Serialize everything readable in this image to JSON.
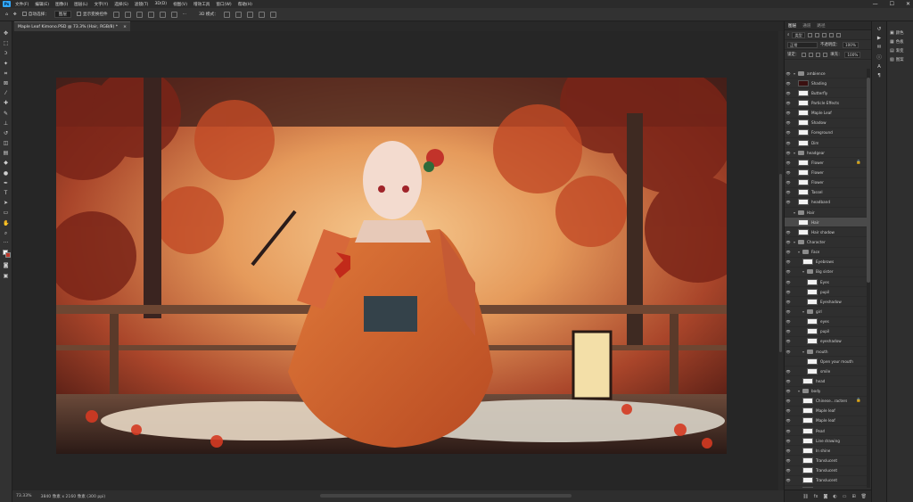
{
  "menu": {
    "items": [
      "文件(F)",
      "编辑(E)",
      "图像(I)",
      "图层(L)",
      "文字(Y)",
      "选择(S)",
      "滤镜(T)",
      "3D(D)",
      "视图(V)",
      "增效工具",
      "窗口(W)",
      "帮助(H)"
    ],
    "logo": "Ps",
    "window_controls": [
      "—",
      "☐",
      "✕"
    ]
  },
  "options": {
    "auto_select_label": "自动选择：",
    "layer_mode": "图层",
    "show_transform_label": "显示变换控件"
  },
  "document": {
    "tab_title": "Maple Leaf Kimono.PSD @ 73.3% (Hair, RGB/8) *",
    "tab_close": "×"
  },
  "status": {
    "zoom": "73.33%",
    "doc_info": "3840 像素 x 2160 像素 (300 ppi)"
  },
  "layers_panel": {
    "tabs": [
      "图层",
      "通道",
      "路径"
    ],
    "filter_label": "类型",
    "blend_mode": "正常",
    "opacity_label": "不透明度：",
    "opacity_value": "100%",
    "lock_label": "锁定：",
    "fill_label": "填充：",
    "fill_value": "100%",
    "layers": [
      {
        "name": "ambience",
        "type": "group",
        "indent": 0,
        "visible": true
      },
      {
        "name": "Shading",
        "type": "layer",
        "indent": 1,
        "visible": true,
        "dark": true
      },
      {
        "name": "Butterfly",
        "type": "layer",
        "indent": 1,
        "visible": true
      },
      {
        "name": "Particle Effects",
        "type": "layer",
        "indent": 1,
        "visible": true
      },
      {
        "name": "Maple Leaf",
        "type": "layer",
        "indent": 1,
        "visible": true
      },
      {
        "name": "Shadow",
        "type": "layer",
        "indent": 1,
        "visible": true
      },
      {
        "name": "Foreground",
        "type": "layer",
        "indent": 1,
        "visible": true
      },
      {
        "name": "Dim",
        "type": "layer",
        "indent": 1,
        "visible": true
      },
      {
        "name": "headgear",
        "type": "group",
        "indent": 0,
        "visible": true
      },
      {
        "name": "Flower",
        "type": "layer",
        "indent": 1,
        "visible": true,
        "locked": true
      },
      {
        "name": "Flower",
        "type": "layer",
        "indent": 1,
        "visible": true
      },
      {
        "name": "Flower",
        "type": "layer",
        "indent": 1,
        "visible": true
      },
      {
        "name": "Tassel",
        "type": "layer",
        "indent": 1,
        "visible": true
      },
      {
        "name": "headband",
        "type": "layer",
        "indent": 1,
        "visible": true
      },
      {
        "name": "Hair",
        "type": "group",
        "indent": 0,
        "visible": false
      },
      {
        "name": "Hair",
        "type": "layer",
        "indent": 1,
        "visible": false,
        "selected": true
      },
      {
        "name": "Hair shadow",
        "type": "layer",
        "indent": 1,
        "visible": true
      },
      {
        "name": "Character",
        "type": "group",
        "indent": 0,
        "visible": true
      },
      {
        "name": "Face",
        "type": "group",
        "indent": 1,
        "visible": true
      },
      {
        "name": "Eyebrows",
        "type": "layer",
        "indent": 2,
        "visible": true
      },
      {
        "name": "Big sister",
        "type": "group",
        "indent": 2,
        "visible": true
      },
      {
        "name": "Eyes",
        "type": "layer",
        "indent": 3,
        "visible": true
      },
      {
        "name": "pupil",
        "type": "layer",
        "indent": 3,
        "visible": true
      },
      {
        "name": "Eyeshadow",
        "type": "layer",
        "indent": 3,
        "visible": true
      },
      {
        "name": "girl",
        "type": "group",
        "indent": 2,
        "visible": true
      },
      {
        "name": "eyes",
        "type": "layer",
        "indent": 3,
        "visible": true
      },
      {
        "name": "pupil",
        "type": "layer",
        "indent": 3,
        "visible": true
      },
      {
        "name": "eyeshadow",
        "type": "layer",
        "indent": 3,
        "visible": true
      },
      {
        "name": "mouth",
        "type": "group",
        "indent": 2,
        "visible": true
      },
      {
        "name": "Open your mouth",
        "type": "layer",
        "indent": 3,
        "visible": false
      },
      {
        "name": "smile",
        "type": "layer",
        "indent": 3,
        "visible": true
      },
      {
        "name": "head",
        "type": "layer",
        "indent": 2,
        "visible": true
      },
      {
        "name": "body",
        "type": "group",
        "indent": 1,
        "visible": true
      },
      {
        "name": "Chinese...racters",
        "type": "layer",
        "indent": 2,
        "visible": true,
        "locked": true
      },
      {
        "name": "Maple leaf",
        "type": "layer",
        "indent": 2,
        "visible": true
      },
      {
        "name": "Maple leaf",
        "type": "layer",
        "indent": 2,
        "visible": true
      },
      {
        "name": "Pearl",
        "type": "layer",
        "indent": 2,
        "visible": true
      },
      {
        "name": "Line drawing",
        "type": "layer",
        "indent": 2,
        "visible": true
      },
      {
        "name": "In shine",
        "type": "layer",
        "indent": 2,
        "visible": true
      },
      {
        "name": "Translucent",
        "type": "layer",
        "indent": 2,
        "visible": true
      },
      {
        "name": "Translucent",
        "type": "layer",
        "indent": 2,
        "visible": true
      },
      {
        "name": "Translucent",
        "type": "layer",
        "indent": 2,
        "visible": true
      },
      {
        "name": "Translucent",
        "type": "layer",
        "indent": 2,
        "visible": true
      }
    ]
  },
  "right_panel": {
    "items": [
      {
        "icon": "▣",
        "label": "颜色"
      },
      {
        "icon": "▦",
        "label": "色板"
      },
      {
        "icon": "▤",
        "label": "渐变"
      },
      {
        "icon": "▧",
        "label": "图案"
      }
    ]
  },
  "colors": {
    "accent": "#31a8ff",
    "background": "#282828",
    "panel": "#2f2f2f"
  }
}
